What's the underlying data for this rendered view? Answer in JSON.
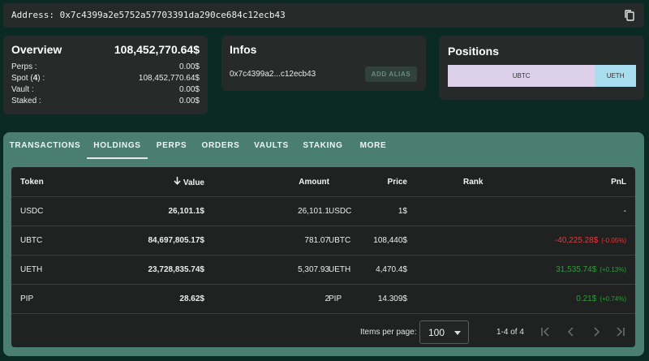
{
  "address_bar": {
    "label": "Address: 0x7c4399a2e5752a57703391da290ce684c12ecb43"
  },
  "overview": {
    "title": "Overview",
    "total": "108,452,770.64$",
    "rows": [
      {
        "label": "Perps :",
        "count": "",
        "suffix": "",
        "value": "0.00$"
      },
      {
        "label": "Spot (",
        "count": "4",
        "suffix": ") :",
        "value": "108,452,770.64$"
      },
      {
        "label": "Vault :",
        "count": "",
        "suffix": "",
        "value": "0.00$"
      },
      {
        "label": "Staked :",
        "count": "",
        "suffix": "",
        "value": "0.00$"
      }
    ]
  },
  "infos": {
    "title": "Infos",
    "short_address": "0x7c4399a2...c12ecb43",
    "alias_button": "ADD ALIAS"
  },
  "positions": {
    "title": "Positions",
    "segments": [
      {
        "label": "UBTC",
        "fraction": 0.781,
        "color": "#dcd0ea"
      },
      {
        "label": "UETH",
        "fraction": 0.219,
        "color": "#a8dcef"
      }
    ]
  },
  "tabs": [
    "TRANSACTIONS",
    "HOLDINGS",
    "PERPS",
    "ORDERS",
    "VAULTS",
    "STAKING",
    "MORE"
  ],
  "active_tab": "HOLDINGS",
  "table": {
    "headers": {
      "token": "Token",
      "value": "Value",
      "amount": "Amount",
      "price": "Price",
      "rank": "Rank",
      "pnl": "PnL"
    },
    "rows": [
      {
        "token": "USDC",
        "value": "26,101.1$",
        "amount": "26,101.1",
        "unit": "USDC",
        "price": "1$",
        "rank": "",
        "pnl": "-",
        "pnl_pct": "",
        "pnl_sign": "none"
      },
      {
        "token": "UBTC",
        "value": "84,697,805.17$",
        "amount": "781.07",
        "unit": "UBTC",
        "price": "108,440$",
        "rank": "",
        "pnl": "-40,225.28$",
        "pnl_pct": "(-0.05%)",
        "pnl_sign": "neg"
      },
      {
        "token": "UETH",
        "value": "23,728,835.74$",
        "amount": "5,307.93",
        "unit": "UETH",
        "price": "4,470.4$",
        "rank": "",
        "pnl": "31,535.74$",
        "pnl_pct": "(+0.13%)",
        "pnl_sign": "pos"
      },
      {
        "token": "PIP",
        "value": "28.62$",
        "amount": "2",
        "unit": "PIP",
        "price": "14.309$",
        "rank": "",
        "pnl": "0.21$",
        "pnl_pct": "(+0.74%)",
        "pnl_sign": "pos"
      }
    ]
  },
  "pagination": {
    "items_per_page_label": "Items per page:",
    "items_per_page": "100",
    "range": "1-4 of 4"
  },
  "colors": {
    "background": "#0b2a23",
    "card": "#262a29",
    "tab_bar": "#4a7e6f",
    "negative": "#e53935",
    "positive": "#2e9e3a"
  }
}
